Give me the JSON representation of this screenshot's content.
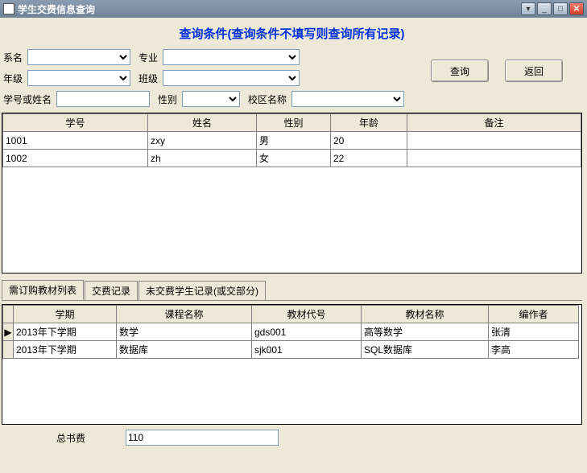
{
  "window": {
    "title": "学生交费信息查询"
  },
  "header": "查询条件(查询条件不填写则查询所有记录)",
  "filters": {
    "dept_label": "系名",
    "major_label": "专业",
    "grade_label": "年级",
    "class_label": "班级",
    "idorname_label": "学号或姓名",
    "sex_label": "性别",
    "campus_label": "校区名称"
  },
  "buttons": {
    "query": "查询",
    "back": "返回"
  },
  "grid1": {
    "cols": [
      "学号",
      "姓名",
      "性别",
      "年龄",
      "备注"
    ],
    "rows": [
      {
        "id": "1001",
        "name": "zxy",
        "sex": "男",
        "age": "20",
        "note": ""
      },
      {
        "id": "1002",
        "name": "zh",
        "sex": "女",
        "age": "22",
        "note": ""
      }
    ]
  },
  "tabs": [
    "需订购教材列表",
    "交费记录",
    "未交费学生记录(或交部分)"
  ],
  "grid2": {
    "cols": [
      "学期",
      "课程名称",
      "教材代号",
      "教材名称",
      "编作者"
    ],
    "rows": [
      {
        "term": "2013年下学期",
        "course": "数学",
        "code": "gds001",
        "book": "高等数学",
        "author": "张清"
      },
      {
        "term": "2013年下学期",
        "course": "数据库",
        "code": "sjk001",
        "book": "SQL数据库",
        "author": "李高"
      }
    ]
  },
  "footer": {
    "total_label": "总书费",
    "total_value": "110"
  }
}
